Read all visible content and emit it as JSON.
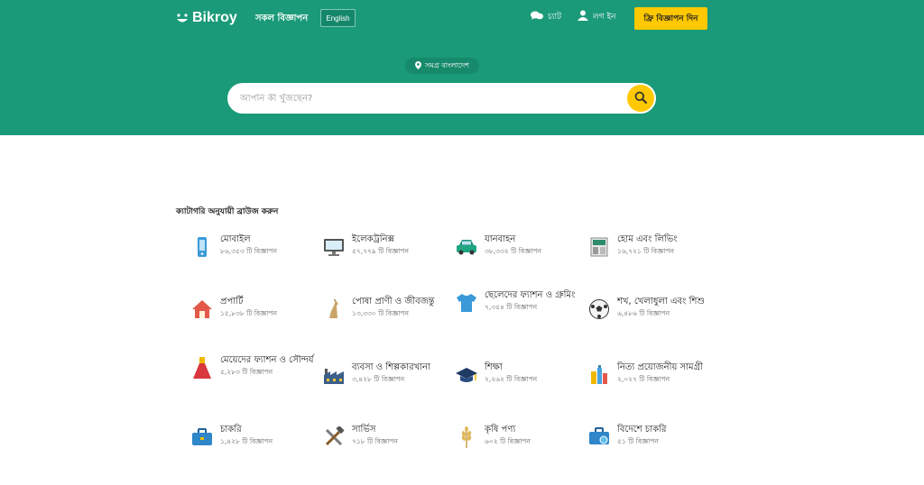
{
  "header": {
    "logo_text": "Bikroy",
    "all_ads_label": "সকল বিজ্ঞাপন",
    "language_label": "English",
    "chat_label": "চ্যাট",
    "login_label": "লগ ইন",
    "post_ad_label": "ফ্রি বিজ্ঞাপন দিন",
    "colors": {
      "brand_green": "#1a9a78",
      "accent_yellow": "#ffc800"
    }
  },
  "hero": {
    "location_label": "সমগ্র বাংলাদেশ",
    "search_placeholder": "আপনি কী খুঁজছেন?"
  },
  "categories": {
    "title": "ক্যাটাগরি অনুযায়ী ব্রাউজ করুন",
    "items": [
      {
        "name": "মোবাইল",
        "count": "৮৬,৩৫৩ টি বিজ্ঞাপন",
        "icon": "mobile-phone-icon"
      },
      {
        "name": "ইলেকট্রনিক্স",
        "count": "৫৭,৭৭৯ টি বিজ্ঞাপন",
        "icon": "monitor-icon"
      },
      {
        "name": "যানবাহন",
        "count": "৩৮,৩৩২ টি বিজ্ঞাপন",
        "icon": "car-icon"
      },
      {
        "name": "হোম এবং লিভিং",
        "count": "১৬,৭২১ টি বিজ্ঞাপন",
        "icon": "home-living-icon"
      },
      {
        "name": "প্রপার্টি",
        "count": "১৫,৮৩৮ টি বিজ্ঞাপন",
        "icon": "house-icon"
      },
      {
        "name": "পোষা প্রাণী ও জীবজন্তু",
        "count": "১৩,৩৩০ টি বিজ্ঞাপন",
        "icon": "pet-icon"
      },
      {
        "name": "ছেলেদের ফ্যাশন ও গ্রুমিং",
        "count": "৭,৩৫৪ টি বিজ্ঞাপন",
        "icon": "tshirt-icon"
      },
      {
        "name": "শখ, খেলাধুলা এবং শিশু",
        "count": "৬,৪৮৬ টি বিজ্ঞাপন",
        "icon": "football-icon"
      },
      {
        "name": "মেয়েদের ফ্যাশন ও সৌন্দর্য",
        "count": "৫,২৮৩ টি বিজ্ঞাপন",
        "icon": "dress-icon"
      },
      {
        "name": "ব্যবসা ও শিল্পকারখানা",
        "count": "৩,৪২৮ টি বিজ্ঞাপন",
        "icon": "factory-icon"
      },
      {
        "name": "শিক্ষা",
        "count": "২,২৬২ টি বিজ্ঞাপন",
        "icon": "graduation-cap-icon"
      },
      {
        "name": "নিত্য প্রয়োজনীয় সামগ্রী",
        "count": "২,০২৭ টি বিজ্ঞাপন",
        "icon": "grocery-icon"
      },
      {
        "name": "চাকরি",
        "count": "১,৪২৮ টি বিজ্ঞাপন",
        "icon": "briefcase-icon"
      },
      {
        "name": "সার্ভিস",
        "count": "৭১৮ টি বিজ্ঞাপন",
        "icon": "tools-icon"
      },
      {
        "name": "কৃষি পণ্য",
        "count": "৬০২ টি বিজ্ঞাপন",
        "icon": "wheat-icon"
      },
      {
        "name": "বিদেশে চাকরি",
        "count": "৫১ টি বিজ্ঞাপন",
        "icon": "overseas-job-icon"
      }
    ]
  }
}
